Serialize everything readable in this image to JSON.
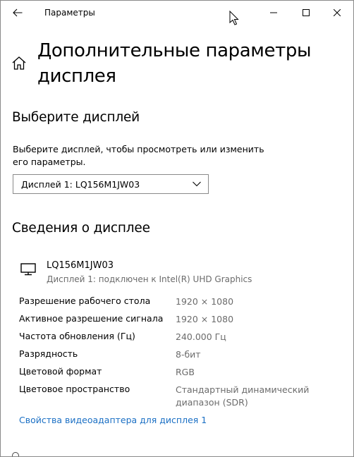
{
  "window": {
    "title": "Параметры",
    "icons": {
      "back": "back-arrow-icon",
      "minimize": "minimize-icon",
      "maximize": "maximize-icon",
      "close": "close-icon",
      "home": "home-icon",
      "monitor": "monitor-icon",
      "chevron": "chevron-down-icon",
      "cursor": "mouse-cursor-icon"
    }
  },
  "page": {
    "title": "Дополнительные параметры дисплея"
  },
  "select_display": {
    "heading": "Выберите дисплей",
    "description": "Выберите дисплей, чтобы просмотреть или изменить его параметры.",
    "dropdown_value": "Дисплей 1: LQ156M1JW03"
  },
  "display_info": {
    "heading": "Сведения о дисплее",
    "name": "LQ156M1JW03",
    "subtitle": "Дисплей 1: подключен к Intel(R) UHD Graphics",
    "rows": [
      {
        "label": "Разрешение рабочего стола",
        "value": "1920 × 1080"
      },
      {
        "label": "Активное разрешение сигнала",
        "value": "1920 × 1080"
      },
      {
        "label": "Частота обновления (Гц)",
        "value": "240.000 Гц"
      },
      {
        "label": "Разрядность",
        "value": "8-бит"
      },
      {
        "label": "Цветовой формат",
        "value": "RGB"
      },
      {
        "label": "Цветовое пространство",
        "value": "Стандартный динамический диапазон (SDR)"
      }
    ],
    "adapter_link": "Свойства видеоадаптера для дисплея 1"
  },
  "colors": {
    "accent_link": "#1a6fc4",
    "secondary_text": "#6b6b6b",
    "border": "#8a8a8a"
  }
}
